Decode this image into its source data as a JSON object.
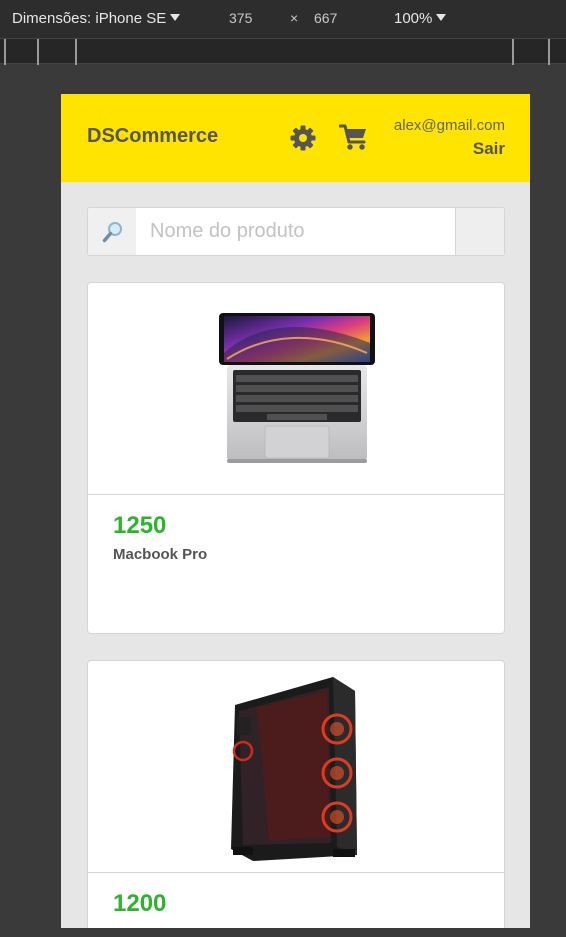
{
  "devtools": {
    "device_label": "Dimensões: iPhone SE",
    "width": "375",
    "times": "×",
    "height": "667",
    "zoom": "100%"
  },
  "header": {
    "brand": "DSCommerce",
    "email": "alex@gmail.com",
    "logout": "Sair"
  },
  "search": {
    "placeholder": "Nome do produto"
  },
  "products": [
    {
      "price": "1250",
      "name": "Macbook Pro"
    },
    {
      "price": "1200",
      "name": ""
    }
  ],
  "colors": {
    "header_bg": "#ffe400",
    "price": "#2cb52c",
    "page_bg": "#e6e6e6"
  },
  "icons": [
    "search-icon",
    "gear-icon",
    "cart-icon"
  ]
}
